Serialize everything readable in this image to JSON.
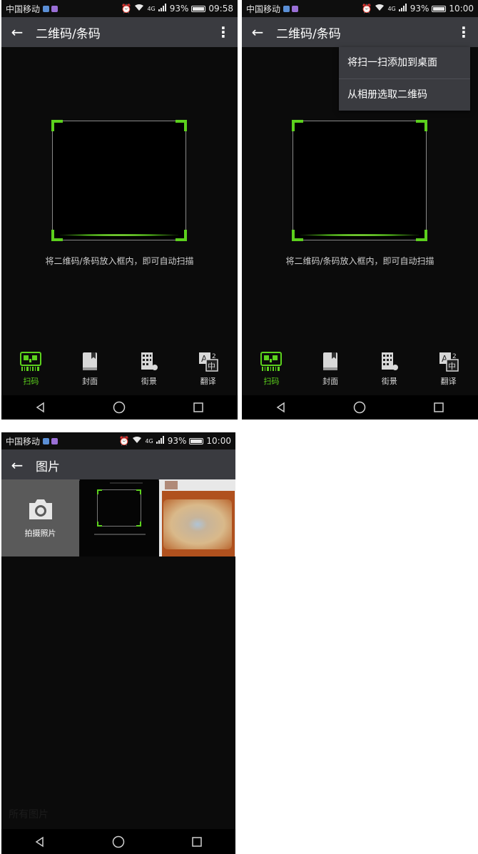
{
  "colors": {
    "accent": "#5cd11d",
    "bar": "#3a3b40",
    "background": "#0b0b0b"
  },
  "status_bar_1": {
    "carrier": "中国移动",
    "network": "4G",
    "battery": "93%",
    "battery_level": 0.93,
    "time": "09:58"
  },
  "status_bar_2": {
    "carrier": "中国移动",
    "network": "4G",
    "battery": "93%",
    "battery_level": 0.93,
    "time": "10:00"
  },
  "status_bar_3": {
    "carrier": "中国移动",
    "network": "4G",
    "battery": "93%",
    "battery_level": 0.93,
    "time": "10:00"
  },
  "scanner": {
    "title": "二维码/条码",
    "hint": "将二维码/条码放入框内，即可自动扫描",
    "tools": [
      {
        "label": "扫码",
        "icon": "qr-scan-icon"
      },
      {
        "label": "封面",
        "icon": "book-cover-icon"
      },
      {
        "label": "街景",
        "icon": "street-view-icon"
      },
      {
        "label": "翻译",
        "icon": "translate-icon"
      }
    ]
  },
  "overflow_menu": {
    "items": [
      "将扫一扫添加到桌面",
      "从相册选取二维码"
    ]
  },
  "gallery": {
    "title": "图片",
    "camera_label": "拍摄照片",
    "folder_label": "所有图片"
  }
}
